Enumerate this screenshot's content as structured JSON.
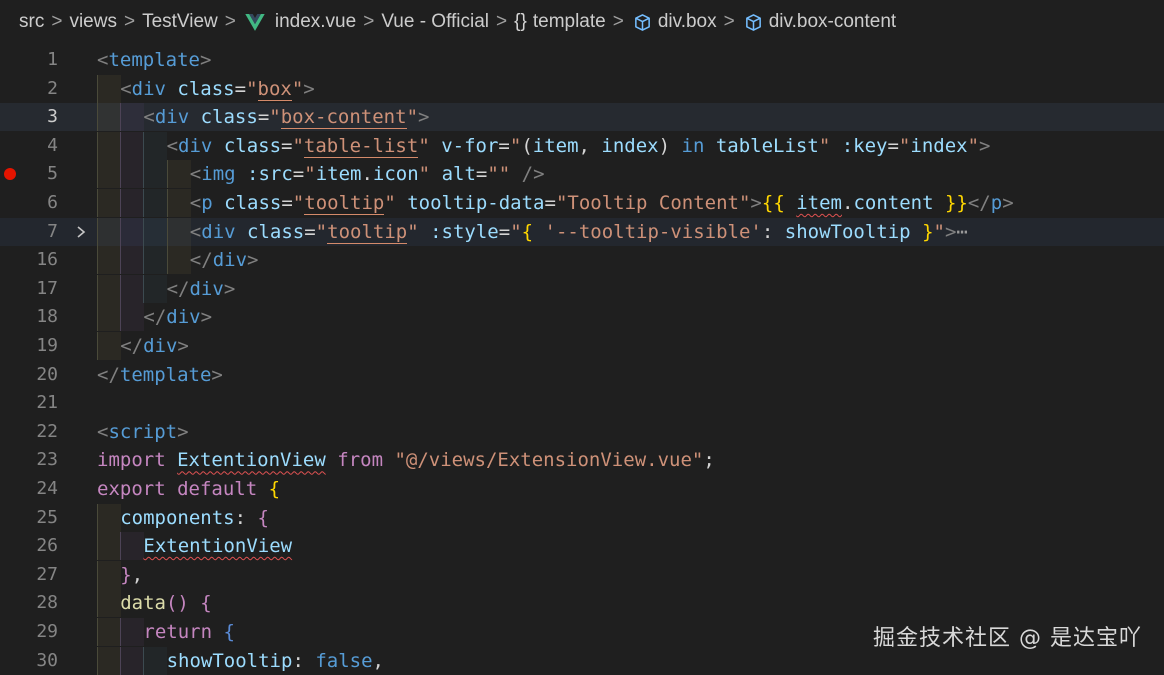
{
  "breadcrumb": {
    "items": [
      "src",
      "views",
      "TestView",
      "index.vue",
      "Vue - Official",
      "template",
      "div.box",
      "div.box-content"
    ],
    "separator": ">",
    "template_prefix": "{}"
  },
  "editor": {
    "breakpoint_line": "5",
    "active_line": "3",
    "folded_line": "7",
    "fold_ellipsis": "⋯",
    "lines": [
      {
        "num": "1",
        "tokens": [
          {
            "t": "<",
            "c": "t"
          },
          {
            "t": "template",
            "c": "n"
          },
          {
            "t": ">",
            "c": "t"
          }
        ]
      },
      {
        "num": "2",
        "tokens": [
          {
            "t": "<",
            "c": "t"
          },
          {
            "t": "div",
            "c": "n"
          },
          {
            "t": " class",
            "c": "a"
          },
          {
            "t": "=",
            "c": "p"
          },
          {
            "t": "\"",
            "c": "s"
          },
          {
            "t": "box",
            "c": "s",
            "ul": true
          },
          {
            "t": "\"",
            "c": "s"
          },
          {
            "t": ">",
            "c": "t"
          }
        ]
      },
      {
        "num": "3",
        "tokens": [
          {
            "t": "<",
            "c": "t"
          },
          {
            "t": "div",
            "c": "n"
          },
          {
            "t": " class",
            "c": "a"
          },
          {
            "t": "=",
            "c": "p"
          },
          {
            "t": "\"",
            "c": "s"
          },
          {
            "t": "box-content",
            "c": "s",
            "ul": true
          },
          {
            "t": "\"",
            "c": "s"
          },
          {
            "t": ">",
            "c": "t"
          }
        ]
      },
      {
        "num": "4",
        "tokens": [
          {
            "t": "<",
            "c": "t"
          },
          {
            "t": "div",
            "c": "n"
          },
          {
            "t": " class",
            "c": "a"
          },
          {
            "t": "=",
            "c": "p"
          },
          {
            "t": "\"",
            "c": "s"
          },
          {
            "t": "table-list",
            "c": "s",
            "ul": true
          },
          {
            "t": "\"",
            "c": "s"
          },
          {
            "t": " v-for",
            "c": "a"
          },
          {
            "t": "=",
            "c": "p"
          },
          {
            "t": "\"",
            "c": "s"
          },
          {
            "t": "(",
            "c": "p"
          },
          {
            "t": "item",
            "c": "v"
          },
          {
            "t": ", ",
            "c": "p"
          },
          {
            "t": "index",
            "c": "v"
          },
          {
            "t": ") ",
            "c": "p"
          },
          {
            "t": "in",
            "c": "b"
          },
          {
            "t": " ",
            "c": "p"
          },
          {
            "t": "tableList",
            "c": "v"
          },
          {
            "t": "\"",
            "c": "s"
          },
          {
            "t": " :key",
            "c": "a"
          },
          {
            "t": "=",
            "c": "p"
          },
          {
            "t": "\"",
            "c": "s"
          },
          {
            "t": "index",
            "c": "v"
          },
          {
            "t": "\"",
            "c": "s"
          },
          {
            "t": ">",
            "c": "t"
          }
        ]
      },
      {
        "num": "5",
        "tokens": [
          {
            "t": "<",
            "c": "t"
          },
          {
            "t": "img",
            "c": "n"
          },
          {
            "t": " :src",
            "c": "a"
          },
          {
            "t": "=",
            "c": "p"
          },
          {
            "t": "\"",
            "c": "s"
          },
          {
            "t": "item",
            "c": "v"
          },
          {
            "t": ".",
            "c": "p"
          },
          {
            "t": "icon",
            "c": "v"
          },
          {
            "t": "\"",
            "c": "s"
          },
          {
            "t": " alt",
            "c": "a"
          },
          {
            "t": "=",
            "c": "p"
          },
          {
            "t": "\"\"",
            "c": "s"
          },
          {
            "t": " />",
            "c": "t"
          }
        ]
      },
      {
        "num": "6",
        "tokens": [
          {
            "t": "<",
            "c": "t"
          },
          {
            "t": "p",
            "c": "n"
          },
          {
            "t": " class",
            "c": "a"
          },
          {
            "t": "=",
            "c": "p"
          },
          {
            "t": "\"",
            "c": "s"
          },
          {
            "t": "tooltip",
            "c": "s",
            "ul": true
          },
          {
            "t": "\"",
            "c": "s"
          },
          {
            "t": " tooltip-data",
            "c": "a"
          },
          {
            "t": "=",
            "c": "p"
          },
          {
            "t": "\"Tooltip Content\"",
            "c": "s"
          },
          {
            "t": ">",
            "c": "t"
          },
          {
            "t": "{{",
            "c": "y"
          },
          {
            "t": " ",
            "c": "p"
          },
          {
            "t": "item",
            "c": "v",
            "wavy": true
          },
          {
            "t": ".",
            "c": "p"
          },
          {
            "t": "content",
            "c": "v"
          },
          {
            "t": " ",
            "c": "p"
          },
          {
            "t": "}}",
            "c": "y"
          },
          {
            "t": "</",
            "c": "t"
          },
          {
            "t": "p",
            "c": "n"
          },
          {
            "t": ">",
            "c": "t"
          }
        ]
      },
      {
        "num": "7",
        "tokens": [
          {
            "t": "<",
            "c": "t"
          },
          {
            "t": "div",
            "c": "n"
          },
          {
            "t": " class",
            "c": "a"
          },
          {
            "t": "=",
            "c": "p"
          },
          {
            "t": "\"",
            "c": "s"
          },
          {
            "t": "tooltip",
            "c": "s",
            "ul": true
          },
          {
            "t": "\"",
            "c": "s"
          },
          {
            "t": " :style",
            "c": "a"
          },
          {
            "t": "=",
            "c": "p"
          },
          {
            "t": "\"",
            "c": "s"
          },
          {
            "t": "{",
            "c": "y"
          },
          {
            "t": " '--tooltip-visible'",
            "c": "s"
          },
          {
            "t": ": ",
            "c": "p"
          },
          {
            "t": "showTooltip",
            "c": "v"
          },
          {
            "t": " ",
            "c": "p"
          },
          {
            "t": "}",
            "c": "y"
          },
          {
            "t": "\"",
            "c": "s"
          },
          {
            "t": ">",
            "c": "t"
          }
        ]
      },
      {
        "num": "16",
        "tokens": [
          {
            "t": "</",
            "c": "t"
          },
          {
            "t": "div",
            "c": "n"
          },
          {
            "t": ">",
            "c": "t"
          }
        ]
      },
      {
        "num": "17",
        "tokens": [
          {
            "t": "</",
            "c": "t"
          },
          {
            "t": "div",
            "c": "n"
          },
          {
            "t": ">",
            "c": "t"
          }
        ]
      },
      {
        "num": "18",
        "tokens": [
          {
            "t": "</",
            "c": "t"
          },
          {
            "t": "div",
            "c": "n"
          },
          {
            "t": ">",
            "c": "t"
          }
        ]
      },
      {
        "num": "19",
        "tokens": [
          {
            "t": "</",
            "c": "t"
          },
          {
            "t": "div",
            "c": "n"
          },
          {
            "t": ">",
            "c": "t"
          }
        ]
      },
      {
        "num": "20",
        "tokens": [
          {
            "t": "</",
            "c": "t"
          },
          {
            "t": "template",
            "c": "n"
          },
          {
            "t": ">",
            "c": "t"
          }
        ]
      },
      {
        "num": "21",
        "tokens": []
      },
      {
        "num": "22",
        "tokens": [
          {
            "t": "<",
            "c": "t"
          },
          {
            "t": "script",
            "c": "n"
          },
          {
            "t": ">",
            "c": "t"
          }
        ]
      },
      {
        "num": "23",
        "tokens": [
          {
            "t": "import",
            "c": "k"
          },
          {
            "t": " ",
            "c": "p"
          },
          {
            "t": "ExtentionView",
            "c": "v",
            "wavy": true
          },
          {
            "t": " ",
            "c": "p"
          },
          {
            "t": "from",
            "c": "k"
          },
          {
            "t": " \"@/views/ExtensionView.vue\"",
            "c": "s"
          },
          {
            "t": ";",
            "c": "p"
          }
        ]
      },
      {
        "num": "24",
        "tokens": [
          {
            "t": "export",
            "c": "k"
          },
          {
            "t": " ",
            "c": "p"
          },
          {
            "t": "default",
            "c": "k"
          },
          {
            "t": " ",
            "c": "p"
          },
          {
            "t": "{",
            "c": "y"
          }
        ]
      },
      {
        "num": "25",
        "tokens": [
          {
            "t": "components",
            "c": "v"
          },
          {
            "t": ": ",
            "c": "p"
          },
          {
            "t": "{",
            "c": "k"
          }
        ]
      },
      {
        "num": "26",
        "tokens": [
          {
            "t": "ExtentionView",
            "c": "v",
            "wavy": true
          }
        ]
      },
      {
        "num": "27",
        "tokens": [
          {
            "t": "}",
            "c": "k"
          },
          {
            "t": ",",
            "c": "p"
          }
        ]
      },
      {
        "num": "28",
        "tokens": [
          {
            "t": "data",
            "c": "f"
          },
          {
            "t": "()",
            "c": "k"
          },
          {
            "t": " ",
            "c": "p"
          },
          {
            "t": "{",
            "c": "k"
          }
        ]
      },
      {
        "num": "29",
        "tokens": [
          {
            "t": "return",
            "c": "k"
          },
          {
            "t": " ",
            "c": "p"
          },
          {
            "t": "{",
            "c": "fe"
          }
        ]
      },
      {
        "num": "30",
        "tokens": [
          {
            "t": "showTooltip",
            "c": "v"
          },
          {
            "t": ": ",
            "c": "p"
          },
          {
            "t": "false",
            "c": "b"
          },
          {
            "t": ",",
            "c": "p"
          }
        ]
      }
    ]
  },
  "watermark": "掘金技术社区 @ 是达宝吖"
}
